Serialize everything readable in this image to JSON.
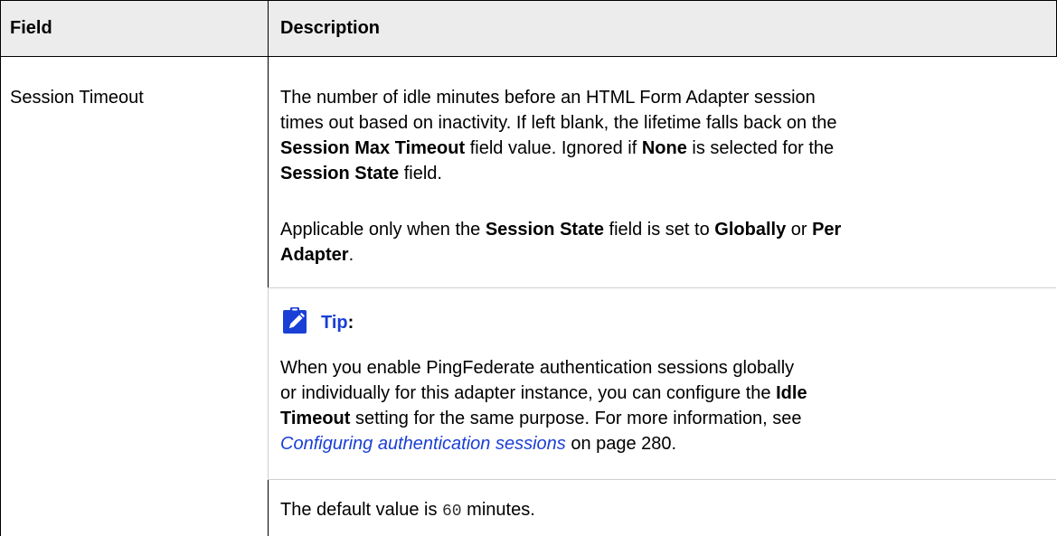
{
  "table": {
    "headers": {
      "field": "Field",
      "description": "Description"
    },
    "row": {
      "field": "Session Timeout",
      "para1": {
        "l1": "The number of idle minutes before an HTML Form Adapter session",
        "l2": "times out based on inactivity. If left blank, the lifetime falls back on the",
        "l3_b1": "Session Max Timeout",
        "l3_t1": " field value. Ignored if ",
        "l3_b2": "None",
        "l3_t2": " is selected for the",
        "l4_b1": "Session State",
        "l4_t1": " field."
      },
      "para2": {
        "t1": "Applicable only when the ",
        "b1": "Session State",
        "t2": " field is set to ",
        "b2": "Globally",
        "t3": " or ",
        "b3": "Per",
        "b4": "Adapter",
        "t4": "."
      },
      "tip": {
        "label": "Tip",
        "colon": ":",
        "l1": "When you enable PingFederate authentication sessions globally",
        "l2_t1": "or individually for this adapter instance, you can configure the ",
        "l2_b1": "Idle",
        "l3_b1": "Timeout",
        "l3_t1": " setting for the same purpose. For more information, see",
        "l4_link": "Configuring authentication sessions",
        "l4_t1": " on page 280."
      },
      "para3": {
        "t1": "The default value is ",
        "code": "60",
        "t2": " minutes."
      }
    }
  },
  "colors": {
    "header_bg": "#ececec",
    "link": "#1a3fd6",
    "tip_icon": "#1a3fd6"
  },
  "icons": {
    "tip": "clipboard-pencil-icon"
  }
}
